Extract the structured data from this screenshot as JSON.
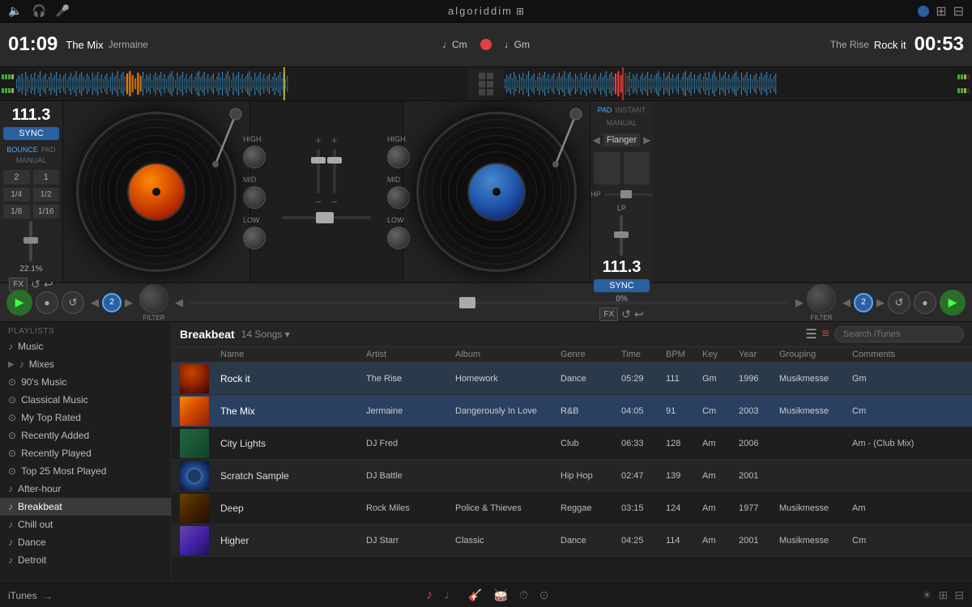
{
  "app": {
    "title": "algoriddim",
    "logo_symbol": "⊞"
  },
  "top_bar": {
    "icons": [
      "🔈",
      "🎧",
      "🎤"
    ],
    "window_controls": [
      "⊙",
      "⊞",
      "⊟"
    ]
  },
  "deck_left": {
    "time": "01:09",
    "label": "The Mix",
    "artist": "Jermaine",
    "key": "♩Cm"
  },
  "deck_right": {
    "time": "00:53",
    "label": "The Rise",
    "track": "Rock it",
    "key": "♩Gm"
  },
  "deck_center": {
    "record_icon": "⏺"
  },
  "left_controls": {
    "bpm": "111.3",
    "sync_label": "SYNC",
    "beat_grid": [
      "2",
      "1",
      "1/4",
      "1/2",
      "1/8",
      "1/16"
    ],
    "percentage": "22.1%",
    "mode_buttons": [
      "BOUNCE",
      "PAD",
      "MANUAL"
    ]
  },
  "right_controls": {
    "bpm": "111.3",
    "sync_label": "SYNC",
    "percentage": "0%",
    "mode_buttons": [
      "PAD",
      "INSTANT",
      "MANUAL"
    ],
    "effect": "Flanger",
    "lp_label": "LP",
    "hp_label": "HP"
  },
  "mixer": {
    "high_label_left": "HIGH",
    "mid_label_left": "MID",
    "low_label_left": "LOW",
    "high_label_right": "HIGH",
    "mid_label_right": "MID",
    "low_label_right": "LOW"
  },
  "transport": {
    "left": {
      "play_label": "▶",
      "cue_label": "●",
      "loop_label": "↺",
      "prev_label": "◀",
      "loop_num": "2",
      "next_label": "▶",
      "filter_label": "FILTER"
    },
    "right": {
      "play_label": "▶",
      "cue_label": "●",
      "loop_label": "↺",
      "prev_label": "◀",
      "loop_num": "2",
      "next_label": "▶",
      "filter_label": "FILTER"
    }
  },
  "playlists": {
    "section_label": "PLAYLISTS",
    "items": [
      {
        "name": "Music",
        "icon": "♪",
        "type": "item"
      },
      {
        "name": "Mixes",
        "icon": "▶",
        "type": "item",
        "expand": true
      },
      {
        "name": "90's Music",
        "icon": "⊙",
        "type": "item"
      },
      {
        "name": "Classical Music",
        "icon": "⊙",
        "type": "item"
      },
      {
        "name": "My Top Rated",
        "icon": "⊙",
        "type": "item"
      },
      {
        "name": "Recently Added",
        "icon": "⊙",
        "type": "item"
      },
      {
        "name": "Recently Played",
        "icon": "⊙",
        "type": "item"
      },
      {
        "name": "Top 25 Most Played",
        "icon": "⊙",
        "type": "item"
      },
      {
        "name": "After-hour",
        "icon": "♪",
        "type": "item"
      },
      {
        "name": "Breakbeat",
        "icon": "♪",
        "type": "item",
        "active": true
      },
      {
        "name": "Chill out",
        "icon": "♪",
        "type": "item"
      },
      {
        "name": "Dance",
        "icon": "♪",
        "type": "item"
      },
      {
        "name": "Detroit",
        "icon": "♪",
        "type": "item"
      }
    ]
  },
  "tracklist": {
    "title": "Breakbeat",
    "count": "14 Songs ▾",
    "search_placeholder": "Search iTunes",
    "columns": [
      "Name",
      "Artist",
      "Album",
      "Genre",
      "Time",
      "BPM",
      "Key",
      "Year",
      "Grouping",
      "Comments"
    ],
    "tracks": [
      {
        "id": 1,
        "name": "Rock it",
        "artist": "The Rise",
        "album": "Homework",
        "genre": "Dance",
        "time": "05:29",
        "bpm": "111",
        "key": "Gm",
        "year": "1996",
        "grouping": "Musikmesse",
        "comments": "Gm",
        "artwork_color1": "#cc4400",
        "artwork_color2": "#882200",
        "playing": true
      },
      {
        "id": 2,
        "name": "The Mix",
        "artist": "Jermaine",
        "album": "Dangerously In Love",
        "genre": "R&B",
        "time": "04:05",
        "bpm": "91",
        "key": "Cm",
        "year": "2003",
        "grouping": "Musikmesse",
        "comments": "Cm",
        "artwork_color1": "#ff8800",
        "artwork_color2": "#cc4400",
        "selected": true
      },
      {
        "id": 3,
        "name": "City Lights",
        "artist": "DJ Fred",
        "album": "",
        "genre": "Club",
        "time": "06:33",
        "bpm": "128",
        "key": "Am",
        "year": "2006",
        "grouping": "",
        "comments": "Am - (Club Mix)",
        "artwork_color1": "#226644",
        "artwork_color2": "#114422"
      },
      {
        "id": 4,
        "name": "Scratch Sample",
        "artist": "DJ Battle",
        "album": "",
        "genre": "Hip Hop",
        "time": "02:47",
        "bpm": "139",
        "key": "Am",
        "year": "2001",
        "grouping": "",
        "comments": "",
        "artwork_color1": "#224488",
        "artwork_color2": "#112244"
      },
      {
        "id": 5,
        "name": "Deep",
        "artist": "Rock Miles",
        "album": "Police & Thieves",
        "genre": "Reggae",
        "time": "03:15",
        "bpm": "124",
        "key": "Am",
        "year": "1977",
        "grouping": "Musikmesse",
        "comments": "Am",
        "artwork_color1": "#884400",
        "artwork_color2": "#442200"
      },
      {
        "id": 6,
        "name": "Higher",
        "artist": "DJ Starr",
        "album": "Classic",
        "genre": "Dance",
        "time": "04:25",
        "bpm": "114",
        "key": "Am",
        "year": "2001",
        "grouping": "Musikmesse",
        "comments": "Cm",
        "artwork_color1": "#6644aa",
        "artwork_color2": "#332266"
      }
    ]
  },
  "bottom_bar": {
    "left": {
      "itunes_label": "iTunes",
      "arrow_label": "→"
    },
    "center_icons": [
      "♪",
      "♩",
      "🎸",
      "🥁",
      "⏱",
      "⊙"
    ],
    "right_icons": [
      "☀",
      "⊞",
      "⊟"
    ]
  }
}
